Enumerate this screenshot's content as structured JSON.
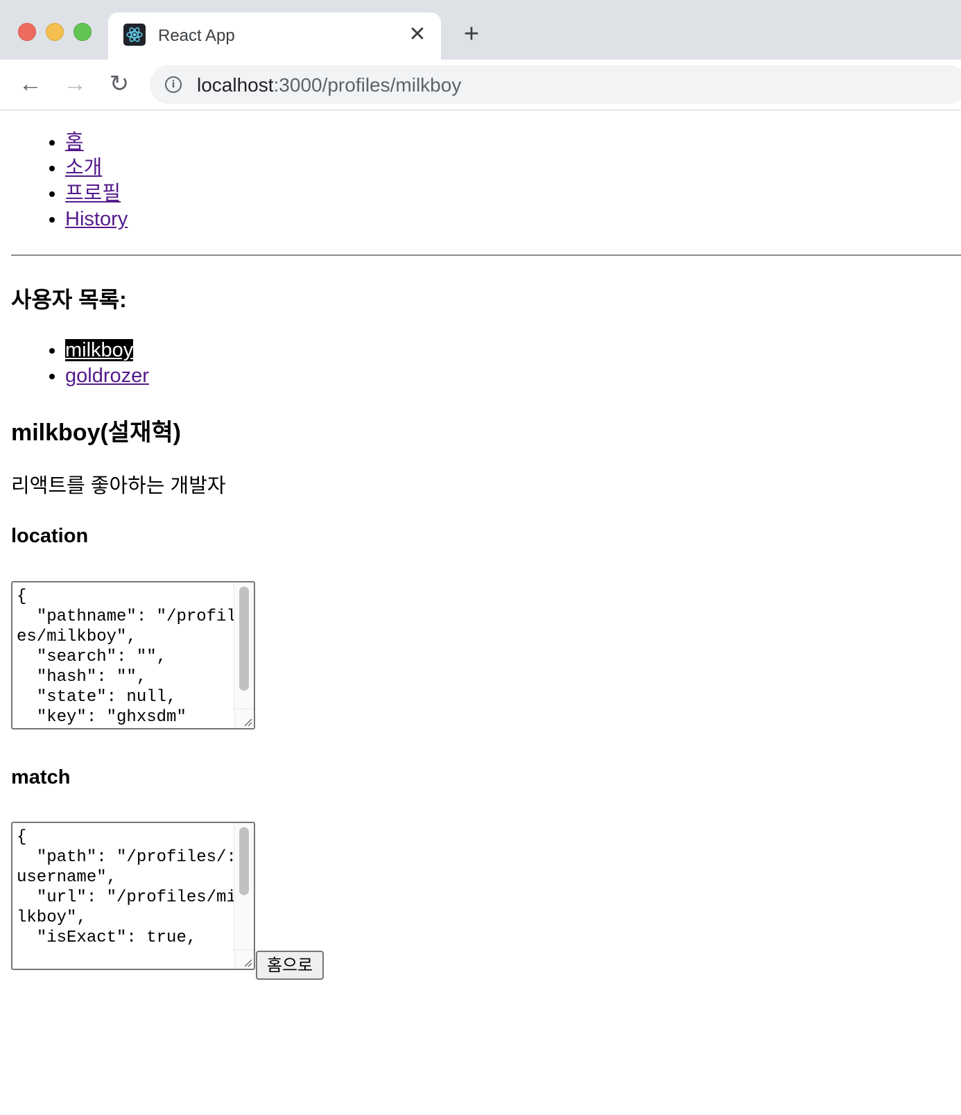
{
  "browser": {
    "tab_title": "React App",
    "tab_close_icon": "close-icon",
    "new_tab_icon": "plus-icon",
    "url_host": "localhost",
    "url_path": ":3000/profiles/milkboy",
    "info_icon": "i"
  },
  "nav": {
    "items": [
      {
        "label": "홈"
      },
      {
        "label": "소개"
      },
      {
        "label": "프로필"
      },
      {
        "label": "History"
      }
    ]
  },
  "users": {
    "title": "사용자 목록:",
    "items": [
      {
        "label": "milkboy",
        "active": true
      },
      {
        "label": "goldrozer",
        "active": false
      }
    ]
  },
  "profile": {
    "title": "milkboy(설재혁)",
    "description": "리액트를 좋아하는 개발자"
  },
  "location": {
    "title": "location",
    "json": "{\n  \"pathname\": \"/profiles/milkboy\",\n  \"search\": \"\",\n  \"hash\": \"\",\n  \"state\": null,\n  \"key\": \"ghxsdm\""
  },
  "match": {
    "title": "match",
    "json": "{\n  \"path\": \"/profiles/:username\",\n  \"url\": \"/profiles/milkboy\",\n  \"isExact\": true,"
  },
  "home_button": {
    "label": "홈으로"
  },
  "colors": {
    "link": "#551a8b",
    "active_bg": "#000000",
    "chrome_bg": "#dee1e6"
  }
}
